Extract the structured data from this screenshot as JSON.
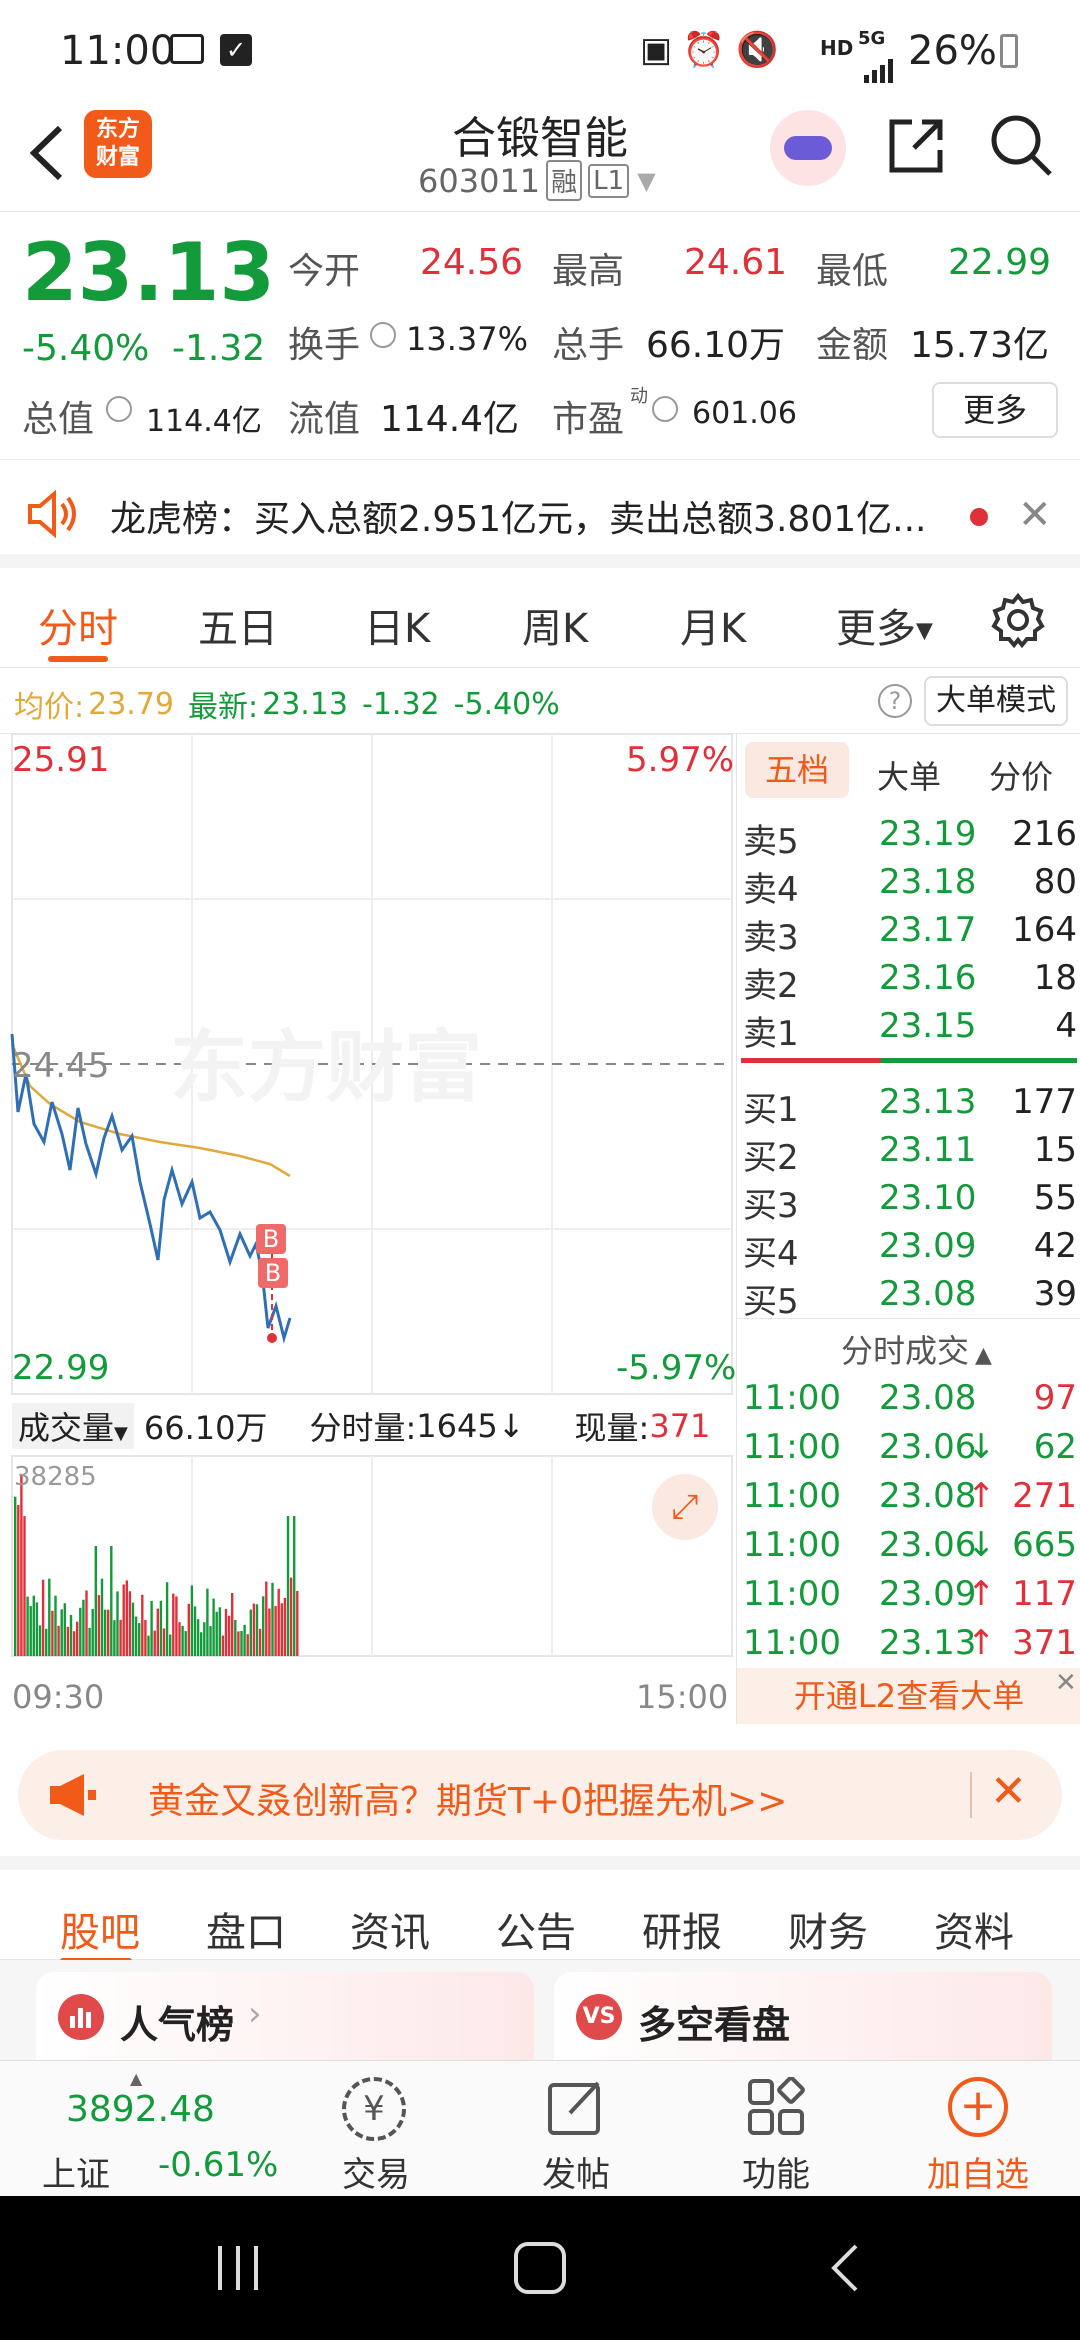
{
  "status_bar": {
    "time": "11:00",
    "battery": "26%",
    "hd": "HD",
    "network": "5G"
  },
  "header": {
    "title": "合锻智能",
    "code": "603011",
    "tag1": "融",
    "tag2": "L1",
    "logo_line1": "东方",
    "logo_line2": "财富"
  },
  "quote": {
    "price": "23.13",
    "change_pct": "-5.40%",
    "change": "-1.32",
    "open_label": "今开",
    "open": "24.56",
    "high_label": "最高",
    "high": "24.61",
    "low_label": "最低",
    "low": "22.99",
    "turnover_label": "换手",
    "turnover": "13.37%",
    "volume_label": "总手",
    "volume": "66.10万",
    "amount_label": "金额",
    "amount": "15.73亿",
    "mktcap_label": "总值",
    "mktcap": "114.4亿",
    "float_label": "流值",
    "float": "114.4亿",
    "pe_label": "市盈",
    "pe_sup": "动",
    "pe": "601.06",
    "more_button": "更多"
  },
  "news": {
    "text": "龙虎榜：买入总额2.951亿元，卖出总额3.801亿..."
  },
  "tabs": [
    "分时",
    "五日",
    "日K",
    "周K",
    "月K",
    "更多"
  ],
  "avg_line": {
    "avg_label": "均价:",
    "avg": "23.79",
    "latest_label": "最新:",
    "latest": "23.13",
    "change": "-1.32",
    "pct": "-5.40%",
    "mode_button": "大单模式"
  },
  "chart": {
    "top_price": "25.91",
    "top_pct": "5.97%",
    "mid_price": "24.45",
    "bottom_price": "22.99",
    "bottom_pct": "-5.97%",
    "watermark": "东方财富",
    "vol_label": "成交量",
    "vol_total": "66.10万",
    "min_vol_label": "分时量:",
    "min_vol": "1645",
    "cur_vol_label": "现量:",
    "cur_vol": "371",
    "vol_max": "38285",
    "time_start": "09:30",
    "time_end": "15:00",
    "marker": "B"
  },
  "book": {
    "tabs": [
      "五档",
      "大单",
      "分价"
    ],
    "asks": [
      {
        "label": "卖5",
        "price": "23.19",
        "vol": "216"
      },
      {
        "label": "卖4",
        "price": "23.18",
        "vol": "80"
      },
      {
        "label": "卖3",
        "price": "23.17",
        "vol": "164"
      },
      {
        "label": "卖2",
        "price": "23.16",
        "vol": "18"
      },
      {
        "label": "卖1",
        "price": "23.15",
        "vol": "4"
      }
    ],
    "bids": [
      {
        "label": "买1",
        "price": "23.13",
        "vol": "177"
      },
      {
        "label": "买2",
        "price": "23.11",
        "vol": "15"
      },
      {
        "label": "买3",
        "price": "23.10",
        "vol": "55"
      },
      {
        "label": "买4",
        "price": "23.09",
        "vol": "42"
      },
      {
        "label": "买5",
        "price": "23.08",
        "vol": "39"
      }
    ],
    "trades_title": "分时成交",
    "trades": [
      {
        "time": "11:00",
        "price": "23.08",
        "arrow": "",
        "vol": "97"
      },
      {
        "time": "11:00",
        "price": "23.06",
        "arrow": "↓",
        "vol": "62"
      },
      {
        "time": "11:00",
        "price": "23.08",
        "arrow": "↑",
        "vol": "271"
      },
      {
        "time": "11:00",
        "price": "23.06",
        "arrow": "↓",
        "vol": "665"
      },
      {
        "time": "11:00",
        "price": "23.09",
        "arrow": "↑",
        "vol": "117"
      },
      {
        "time": "11:00",
        "price": "23.13",
        "arrow": "↑",
        "vol": "371"
      }
    ],
    "l2_button": "开通L2查看大单"
  },
  "banner": {
    "text": "黄金又叒创新高？期货T+0把握先机>>"
  },
  "bottom_tabs": [
    "股吧",
    "盘口",
    "资讯",
    "公告",
    "研报",
    "财务",
    "资料"
  ],
  "cards": {
    "left": "人气榜",
    "right": "多空看盘"
  },
  "toolbar": {
    "index_value": "3892.48",
    "index_name": "上证",
    "index_pct": "-0.61%",
    "trade": "交易",
    "post": "发帖",
    "func": "功能",
    "add": "加自选"
  },
  "colors": {
    "up": "#e0313a",
    "down": "#139a3a",
    "accent": "#f25a19",
    "avg_line": "#e0a93a",
    "price_line": "#2f6fb5"
  }
}
